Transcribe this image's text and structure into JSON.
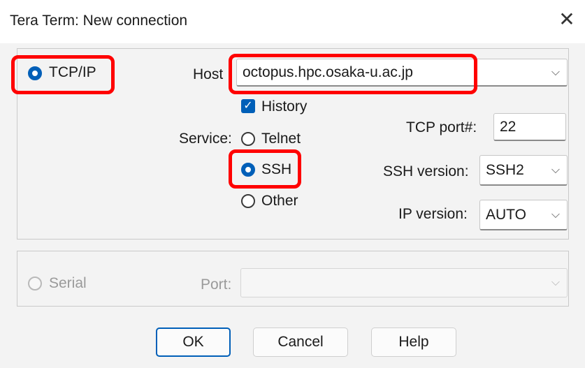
{
  "window": {
    "title": "Tera Term: New connection",
    "close_glyph": "✕"
  },
  "tcpip": {
    "label": "TCP/IP",
    "host_label": "Host",
    "host_value": "octopus.hpc.osaka-u.ac.jp",
    "history_label": "History",
    "service_label": "Service:",
    "services": {
      "telnet": "Telnet",
      "ssh": "SSH",
      "other": "Other"
    },
    "tcp_port_label": "TCP port#:",
    "tcp_port_value": "22",
    "ssh_version_label": "SSH version:",
    "ssh_version_value": "SSH2",
    "ip_version_label": "IP version:",
    "ip_version_value": "AUTO"
  },
  "serial": {
    "label": "Serial",
    "port_label": "Port:",
    "port_value": ""
  },
  "buttons": {
    "ok": "OK",
    "cancel": "Cancel",
    "help": "Help"
  },
  "icons": {
    "chevron": "⌵",
    "check": "✓"
  },
  "colors": {
    "accent": "#005fb8",
    "highlight": "#ff0000"
  }
}
